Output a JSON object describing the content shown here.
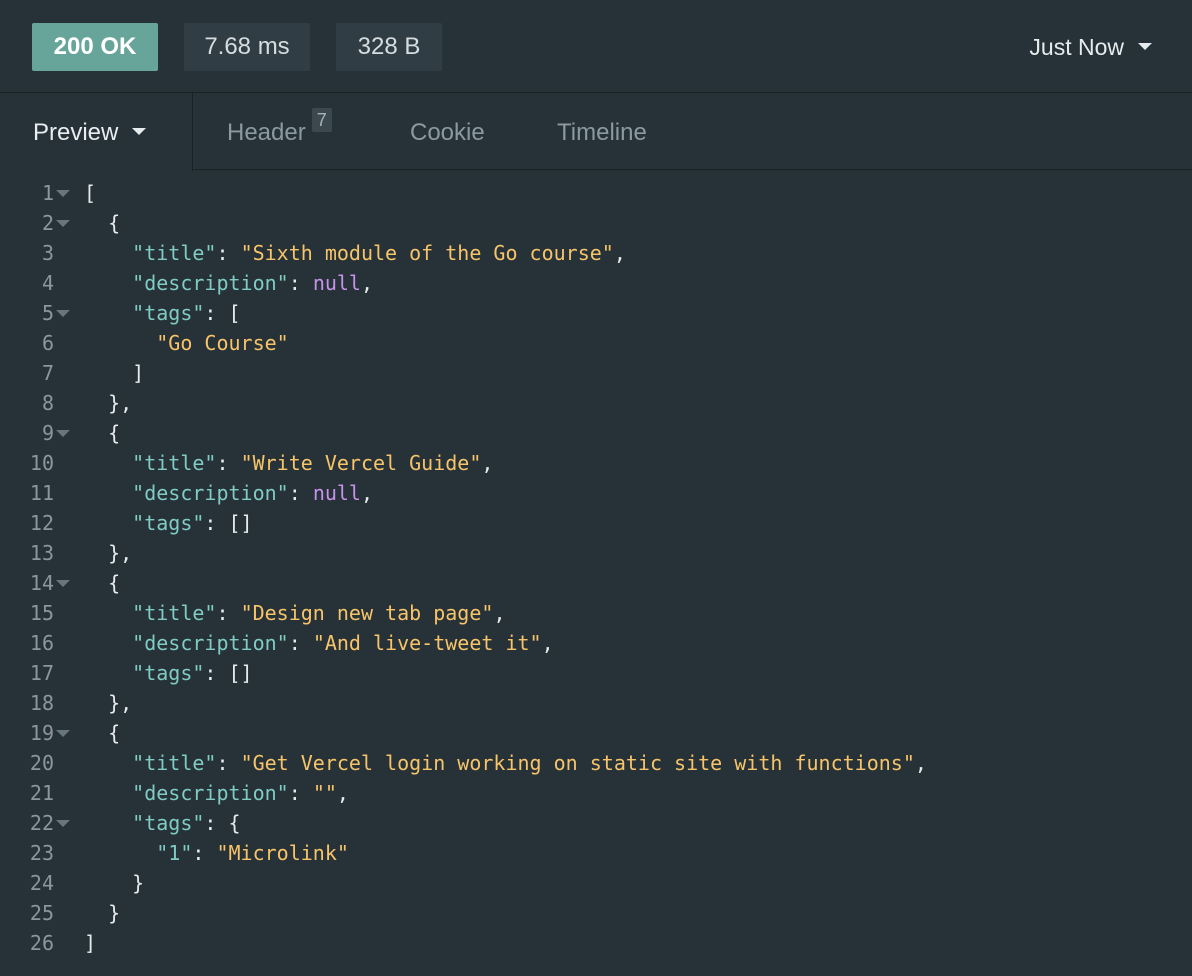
{
  "status_bar": {
    "status": "200 OK",
    "time": "7.68 ms",
    "size": "328 B",
    "history": "Just Now"
  },
  "tabs": {
    "preview": "Preview",
    "header": "Header",
    "header_count": "7",
    "cookie": "Cookie",
    "timeline": "Timeline"
  },
  "colors": {
    "status_ok": "#67a59a",
    "key": "#80cbc4",
    "string": "#f7c46a",
    "null": "#c792ea",
    "background": "#263238"
  },
  "code_lines": [
    {
      "n": "1",
      "fold": true,
      "tokens": [
        [
          "p",
          "["
        ]
      ]
    },
    {
      "n": "2",
      "fold": true,
      "tokens": [
        [
          "p",
          "  {"
        ]
      ]
    },
    {
      "n": "3",
      "fold": false,
      "tokens": [
        [
          "p",
          "    "
        ],
        [
          "k",
          "\"title\""
        ],
        [
          "p",
          ": "
        ],
        [
          "s",
          "\"Sixth module of the Go course\""
        ],
        [
          "p",
          ","
        ]
      ]
    },
    {
      "n": "4",
      "fold": false,
      "tokens": [
        [
          "p",
          "    "
        ],
        [
          "k",
          "\"description\""
        ],
        [
          "p",
          ": "
        ],
        [
          "n",
          "null"
        ],
        [
          "p",
          ","
        ]
      ]
    },
    {
      "n": "5",
      "fold": true,
      "tokens": [
        [
          "p",
          "    "
        ],
        [
          "k",
          "\"tags\""
        ],
        [
          "p",
          ": ["
        ]
      ]
    },
    {
      "n": "6",
      "fold": false,
      "tokens": [
        [
          "p",
          "      "
        ],
        [
          "s",
          "\"Go Course\""
        ]
      ]
    },
    {
      "n": "7",
      "fold": false,
      "tokens": [
        [
          "p",
          "    ]"
        ]
      ]
    },
    {
      "n": "8",
      "fold": false,
      "tokens": [
        [
          "p",
          "  },"
        ]
      ]
    },
    {
      "n": "9",
      "fold": true,
      "tokens": [
        [
          "p",
          "  {"
        ]
      ]
    },
    {
      "n": "10",
      "fold": false,
      "tokens": [
        [
          "p",
          "    "
        ],
        [
          "k",
          "\"title\""
        ],
        [
          "p",
          ": "
        ],
        [
          "s",
          "\"Write Vercel Guide\""
        ],
        [
          "p",
          ","
        ]
      ]
    },
    {
      "n": "11",
      "fold": false,
      "tokens": [
        [
          "p",
          "    "
        ],
        [
          "k",
          "\"description\""
        ],
        [
          "p",
          ": "
        ],
        [
          "n",
          "null"
        ],
        [
          "p",
          ","
        ]
      ]
    },
    {
      "n": "12",
      "fold": false,
      "tokens": [
        [
          "p",
          "    "
        ],
        [
          "k",
          "\"tags\""
        ],
        [
          "p",
          ": []"
        ]
      ]
    },
    {
      "n": "13",
      "fold": false,
      "tokens": [
        [
          "p",
          "  },"
        ]
      ]
    },
    {
      "n": "14",
      "fold": true,
      "tokens": [
        [
          "p",
          "  {"
        ]
      ]
    },
    {
      "n": "15",
      "fold": false,
      "tokens": [
        [
          "p",
          "    "
        ],
        [
          "k",
          "\"title\""
        ],
        [
          "p",
          ": "
        ],
        [
          "s",
          "\"Design new tab page\""
        ],
        [
          "p",
          ","
        ]
      ]
    },
    {
      "n": "16",
      "fold": false,
      "tokens": [
        [
          "p",
          "    "
        ],
        [
          "k",
          "\"description\""
        ],
        [
          "p",
          ": "
        ],
        [
          "s",
          "\"And live-tweet it\""
        ],
        [
          "p",
          ","
        ]
      ]
    },
    {
      "n": "17",
      "fold": false,
      "tokens": [
        [
          "p",
          "    "
        ],
        [
          "k",
          "\"tags\""
        ],
        [
          "p",
          ": []"
        ]
      ]
    },
    {
      "n": "18",
      "fold": false,
      "tokens": [
        [
          "p",
          "  },"
        ]
      ]
    },
    {
      "n": "19",
      "fold": true,
      "tokens": [
        [
          "p",
          "  {"
        ]
      ]
    },
    {
      "n": "20",
      "fold": false,
      "tokens": [
        [
          "p",
          "    "
        ],
        [
          "k",
          "\"title\""
        ],
        [
          "p",
          ": "
        ],
        [
          "s",
          "\"Get Vercel login working on static site with functions\""
        ],
        [
          "p",
          ","
        ]
      ]
    },
    {
      "n": "21",
      "fold": false,
      "tokens": [
        [
          "p",
          "    "
        ],
        [
          "k",
          "\"description\""
        ],
        [
          "p",
          ": "
        ],
        [
          "s",
          "\"\""
        ],
        [
          "p",
          ","
        ]
      ]
    },
    {
      "n": "22",
      "fold": true,
      "tokens": [
        [
          "p",
          "    "
        ],
        [
          "k",
          "\"tags\""
        ],
        [
          "p",
          ": {"
        ]
      ]
    },
    {
      "n": "23",
      "fold": false,
      "tokens": [
        [
          "p",
          "      "
        ],
        [
          "k",
          "\"1\""
        ],
        [
          "p",
          ": "
        ],
        [
          "s",
          "\"Microlink\""
        ]
      ]
    },
    {
      "n": "24",
      "fold": false,
      "tokens": [
        [
          "p",
          "    }"
        ]
      ]
    },
    {
      "n": "25",
      "fold": false,
      "tokens": [
        [
          "p",
          "  }"
        ]
      ]
    },
    {
      "n": "26",
      "fold": false,
      "tokens": [
        [
          "p",
          "]"
        ]
      ]
    }
  ]
}
